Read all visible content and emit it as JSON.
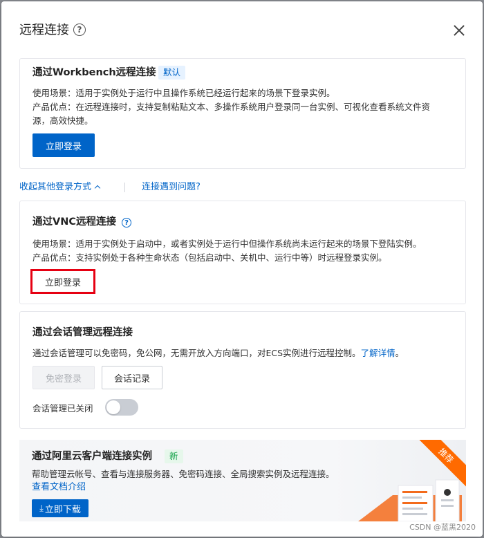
{
  "dialog": {
    "title": "远程连接",
    "close_label": "×"
  },
  "workbench": {
    "title": "通过Workbench远程连接",
    "badge": "默认",
    "scenario": "使用场景：适用于实例处于运行中且操作系统已经运行起来的场景下登录实例。",
    "advantage_line1": "产品优点：在远程连接时，支持复制粘贴文本、多操作系统用户登录同一台实例、可视化查看系统文件资",
    "advantage_line2": "源，高效快捷。",
    "login_button": "立即登录"
  },
  "links": {
    "collapse_other": "收起其他登录方式",
    "connection_issue": "连接遇到问题?"
  },
  "vnc": {
    "title": "通过VNC远程连接",
    "scenario": "使用场景：适用于实例处于启动中，或者实例处于运行中但操作系统尚未运行起来的场景下登陆实例。",
    "advantage": "产品优点：支持实例处于各种生命状态（包括启动中、关机中、运行中等）时远程登录实例。",
    "login_button": "立即登录"
  },
  "session": {
    "title": "通过会话管理远程连接",
    "description": "通过会话管理可以免密码，免公网，无需开放入方向端口，对ECS实例进行远程控制。",
    "learn_more": "了解详情",
    "description_end": "。",
    "passwordless_button": "免密登录",
    "records_button": "会话记录",
    "status_label": "会话管理已关闭",
    "toggle_on": false
  },
  "client": {
    "title": "通过阿里云客户端连接实例",
    "badge": "新",
    "description": "帮助管理云帐号、查看与连接服务器、免密码连接、全局搜索实例及远程连接。",
    "doc_link": "查看文档介绍",
    "download_button": "立即下载",
    "ribbon": "推荐"
  },
  "watermark": "CSDN @蓝黑2020",
  "colors": {
    "primary": "#0064c8",
    "highlight": "#e60012",
    "ribbon": "#ff6a00"
  }
}
